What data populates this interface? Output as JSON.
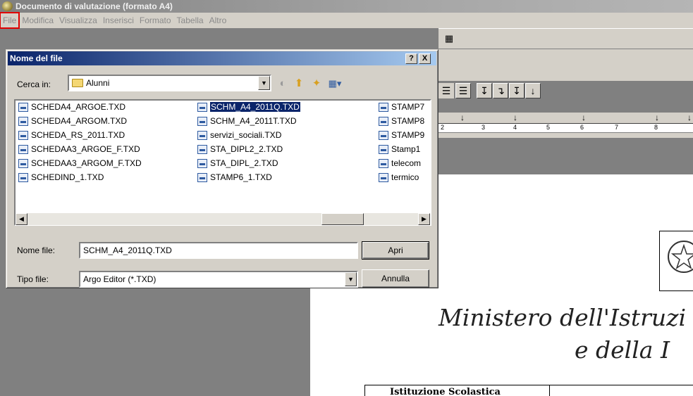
{
  "window": {
    "title": "Documento di valutazione (formato A4)"
  },
  "menu": {
    "items": [
      "File",
      "Modifica",
      "Visualizza",
      "Inserisci",
      "Formato",
      "Tabella",
      "Altro"
    ]
  },
  "toolbar": {
    "indent_buttons": [
      "↧",
      "↴",
      "↧",
      "↓"
    ]
  },
  "ruler": {
    "numbers": [
      "2",
      "3",
      "4",
      "5",
      "6",
      "7",
      "8"
    ]
  },
  "dialog": {
    "title": "Nome del file",
    "help_label": "?",
    "close_label": "X",
    "look_in_label": "Cerca in:",
    "look_in_value": "Alunni",
    "files_col1": [
      "SCHEDA4_ARGOE.TXD",
      "SCHEDA4_ARGOM.TXD",
      "SCHEDA_RS_2011.TXD",
      "SCHEDAA3_ARGOE_F.TXD",
      "SCHEDAA3_ARGOM_F.TXD",
      "SCHEDIND_1.TXD"
    ],
    "files_col2": [
      "SCHM_A4_2011Q.TXD",
      "SCHM_A4_2011T.TXD",
      "servizi_sociali.TXD",
      "STA_DIPL2_2.TXD",
      "STA_DIPL_2.TXD",
      "STAMP6_1.TXD"
    ],
    "files_col3": [
      "STAMP7",
      "STAMP8",
      "STAMP9",
      "Stamp1",
      "telecom",
      "termico"
    ],
    "selected_file": "SCHM_A4_2011Q.TXD",
    "filename_label": "Nome file:",
    "filename_value": "SCHM_A4_2011Q.TXD",
    "filetype_label": "Tipo file:",
    "filetype_value": "Argo Editor (*.TXD)",
    "open_button": "Apri",
    "cancel_button": "Annulla"
  },
  "document": {
    "ministry_line1": "Ministero dell'Istruzi",
    "ministry_line2": "e della I",
    "institution_label": "Istituzione Scolastica"
  },
  "colors": {
    "highlight": "#e00000",
    "dialog_title": "#0a246a",
    "selection": "#0a246a"
  }
}
